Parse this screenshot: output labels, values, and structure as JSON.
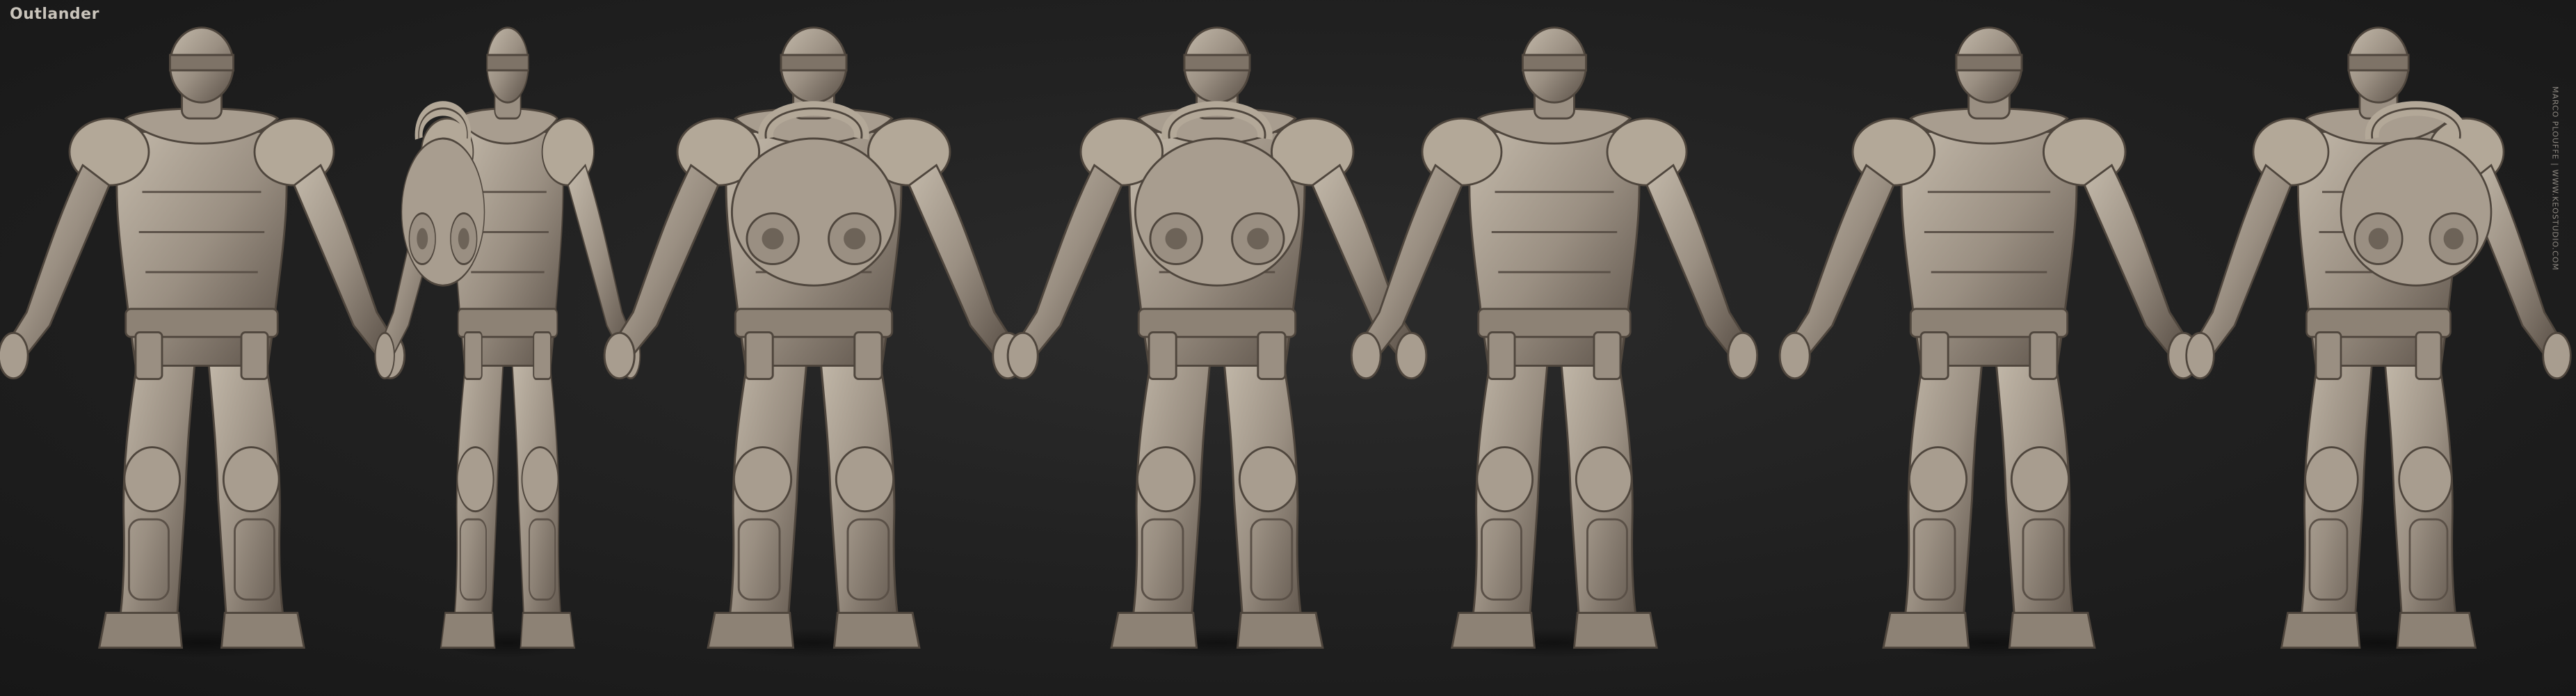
{
  "title": "Outlander",
  "credit": "MARCO PLOUFFE | WWW.KEOSTUDIO.COM",
  "colors": {
    "background": "#1d1d1d",
    "clay": "#9a8f82",
    "clay_light": "#c3b9aa",
    "clay_dark": "#4f463d",
    "title": "#c9c4bb"
  },
  "figures": [
    {
      "view": "front-three-quarter",
      "pack": false
    },
    {
      "view": "side",
      "pack": true
    },
    {
      "view": "back-three-quarter",
      "pack": true
    },
    {
      "view": "back",
      "pack": true
    },
    {
      "view": "front",
      "pack": false
    },
    {
      "view": "front-three-quarter-right",
      "pack": false
    },
    {
      "view": "back-three-quarter-right",
      "pack": true
    }
  ]
}
